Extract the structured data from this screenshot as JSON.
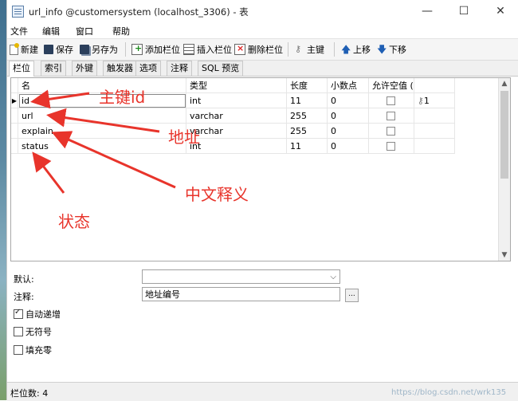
{
  "window": {
    "title": "url_info @customersystem (localhost_3306) - 表",
    "controls": [
      "—",
      "☐",
      "✕"
    ]
  },
  "menu": [
    "文件",
    "编辑",
    "窗口",
    "帮助"
  ],
  "toolbar": [
    {
      "label": "新建",
      "icon": "new-doc-icon"
    },
    {
      "label": "保存",
      "icon": "save-icon"
    },
    {
      "label": "另存为",
      "icon": "save-as-icon"
    },
    {
      "label": "添加栏位",
      "icon": "add-column-icon"
    },
    {
      "label": "插入栏位",
      "icon": "insert-column-icon"
    },
    {
      "label": "删除栏位",
      "icon": "delete-column-icon"
    },
    {
      "label": "主键",
      "icon": "key-icon"
    },
    {
      "label": "上移",
      "icon": "arrow-up-icon"
    },
    {
      "label": "下移",
      "icon": "arrow-down-icon"
    }
  ],
  "tabs": [
    "栏位",
    "索引",
    "外键",
    "触发器",
    "选项",
    "注释",
    "SQL 预览"
  ],
  "grid": {
    "headers": [
      "名",
      "类型",
      "长度",
      "小数点",
      "允许空值 (",
      ""
    ],
    "rows": [
      {
        "name": "id",
        "type": "int",
        "length": "11",
        "decimals": "0",
        "key": "1",
        "selected": true
      },
      {
        "name": "url",
        "type": "varchar",
        "length": "255",
        "decimals": "0",
        "key": "",
        "selected": false
      },
      {
        "name": "explain",
        "type": "varchar",
        "length": "255",
        "decimals": "0",
        "key": "",
        "selected": false
      },
      {
        "name": "status",
        "type": "int",
        "length": "11",
        "decimals": "0",
        "key": "",
        "selected": false
      }
    ]
  },
  "props": {
    "default_label": "默认:",
    "default_value": "",
    "comment_label": "注释:",
    "comment_value": "地址编号",
    "ellipsis": "...",
    "auto_increment": "自动递增",
    "unsigned": "无符号",
    "zerofill": "填充零"
  },
  "status": "栏位数: 4",
  "watermark": "https://blog.csdn.net/wrk135",
  "annotations": {
    "primary_key": "主键id",
    "address": "地址",
    "chinese": "中文释义",
    "status": "状态"
  },
  "colors": {
    "annotation": "#e8342b",
    "selection_row": "#ffffff"
  }
}
